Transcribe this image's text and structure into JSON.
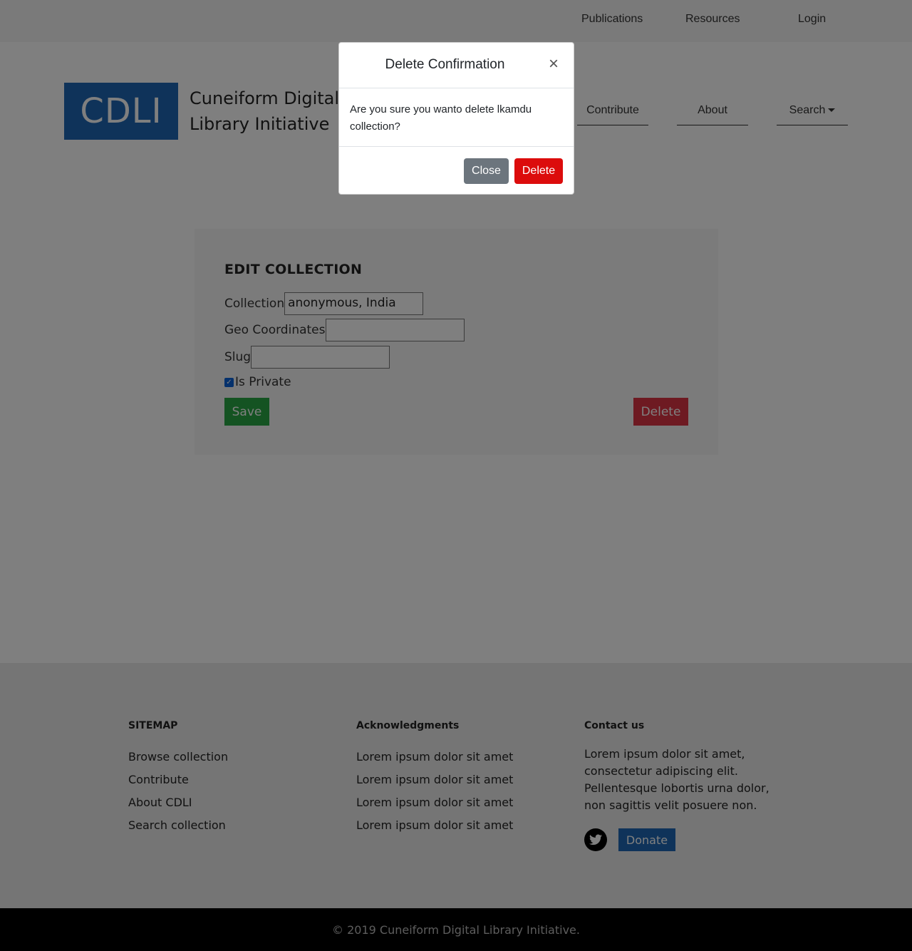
{
  "top_nav": {
    "publications": "Publications",
    "resources": "Resources",
    "login": "Login"
  },
  "brand": {
    "logo": "CDLI",
    "name": "Cuneiform Digital Library Initiative"
  },
  "main_nav": {
    "contribute": "Contribute",
    "about": "About",
    "search": "Search"
  },
  "edit_panel": {
    "title": "EDIT COLLECTION",
    "collection_label": "Collection",
    "collection_value": "anonymous, India",
    "geo_label": "Geo Coordinates",
    "geo_value": "",
    "slug_label": "Slug",
    "slug_value": "",
    "is_private_label": "Is Private",
    "is_private_checked": true,
    "save_label": "Save",
    "delete_label": "Delete"
  },
  "footer": {
    "sitemap_title": "SITEMAP",
    "sitemap_items": [
      "Browse collection",
      "Contribute",
      "About CDLI",
      "Search collection"
    ],
    "ack_title": "Acknowledgments",
    "ack_items": [
      "Lorem ipsum dolor sit amet",
      "Lorem ipsum dolor sit amet",
      "Lorem ipsum dolor sit amet",
      "Lorem ipsum dolor sit amet"
    ],
    "contact_title": "Contact us",
    "contact_text": "Lorem ipsum dolor sit amet, consectetur adipiscing elit. Pellentesque lobortis urna dolor, non sagittis velit posuere non.",
    "donate_label": "Donate",
    "copyright": "© 2019 Cuneiform Digital Library Initiative."
  },
  "modal": {
    "title": "Delete Confirmation",
    "close_glyph": "×",
    "body": "Are you sure you wanto delete lkamdu collection?",
    "close_button": "Close",
    "delete_button": "Delete"
  },
  "colors": {
    "brand": "#1f67b4",
    "save": "#28a745",
    "danger": "#dc3545",
    "modal_delete": "#dc0c0c",
    "secondary": "#6c757d"
  },
  "icons": {
    "twitter": "twitter-icon",
    "caret": "caret-down-icon",
    "close": "close-icon",
    "checkbox": "checkbox-checked-icon"
  }
}
